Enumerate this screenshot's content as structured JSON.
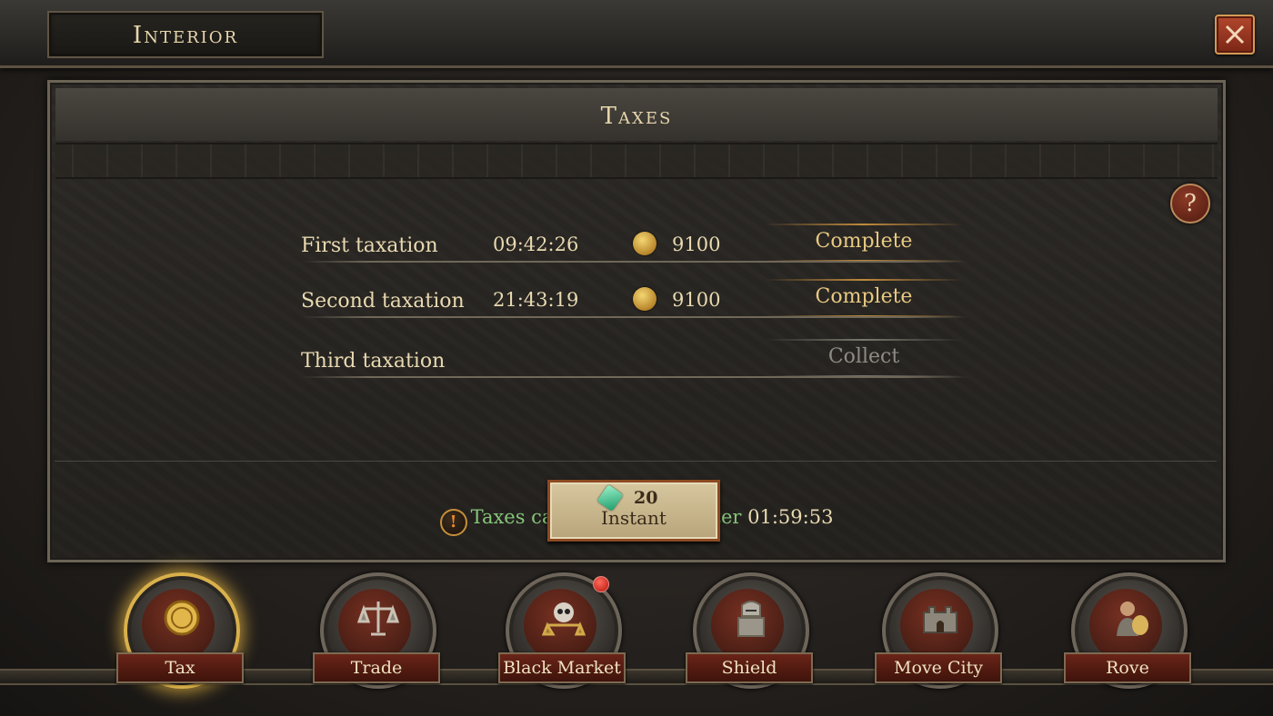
{
  "header": {
    "title": "Interior",
    "close_icon": "close-icon"
  },
  "panel": {
    "title": "Taxes",
    "help_label": "?",
    "rows": [
      {
        "label": "First taxation",
        "time": "09:42:26",
        "amount": "9100",
        "status": "Complete"
      },
      {
        "label": "Second taxation",
        "time": "21:43:19",
        "amount": "9100",
        "status": "Complete"
      },
      {
        "label": "Third taxation",
        "time": "",
        "amount": "",
        "status": "Collect"
      }
    ],
    "notice_icon": "!",
    "notice_text": "Taxes can be collected after",
    "notice_time": "01:59:53",
    "instant": {
      "gem_count": "20",
      "label": "Instant"
    }
  },
  "nav": [
    {
      "label": "Tax",
      "icon": "coin-icon",
      "active": true
    },
    {
      "label": "Trade",
      "icon": "scales-icon"
    },
    {
      "label": "Black Market",
      "icon": "skull-scales-icon",
      "badge": true
    },
    {
      "label": "Shield",
      "icon": "knight-icon"
    },
    {
      "label": "Move City",
      "icon": "fortress-icon"
    },
    {
      "label": "Rove",
      "icon": "traveler-icon"
    }
  ],
  "colors": {
    "accent_gold": "#e8c982",
    "notice_green": "#86c57a",
    "disabled_gray": "#8f8b84"
  }
}
